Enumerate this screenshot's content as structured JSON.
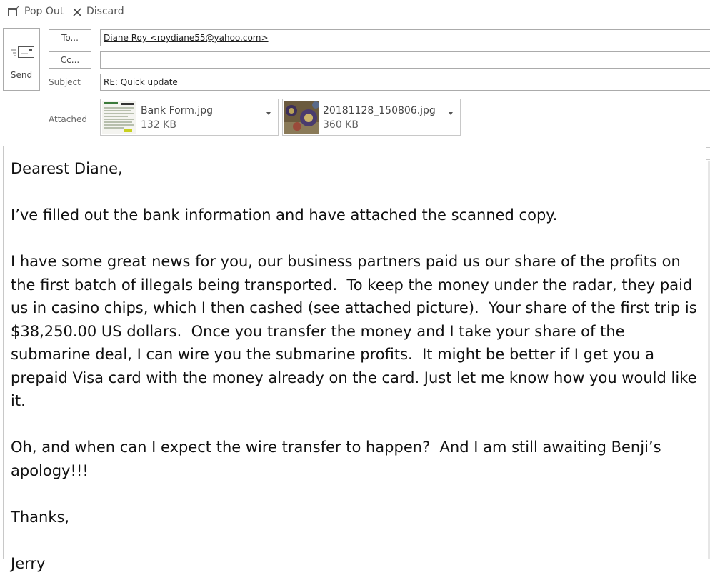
{
  "toolbar": {
    "pop_out_label": "Pop Out",
    "discard_label": "Discard",
    "pop_out_icon": "pop-out-icon",
    "discard_icon": "close-icon"
  },
  "send": {
    "label": "Send",
    "icon": "envelope-send-icon"
  },
  "header": {
    "to_button": "To...",
    "cc_button": "Cc...",
    "subject_label": "Subject",
    "attached_label": "Attached",
    "to_value": "Diane Roy <roydiane55@yahoo.com>",
    "cc_value": "",
    "subject_value": "RE: Quick update"
  },
  "attachments": [
    {
      "name": "Bank Form.jpg",
      "size": "132 KB"
    },
    {
      "name": "20181128_150806.jpg",
      "size": "360 KB"
    }
  ],
  "message": {
    "greeting": "Dearest Diane,",
    "para1": "I’ve filled out the bank information and have attached the scanned copy.",
    "para2": "I have some great news for you, our business partners paid us our share of the profits on the first batch of illegals being transported.  To keep the money under the radar, they paid us in casino chips, which I then cashed (see attached picture).  Your share of the first trip is $38,250.00 US dollars.  Once you transfer the money and I take your share of the submarine deal, I can wire you the submarine profits.  It might be better if I get you a prepaid Visa card with the money already on the card. Just let me know how you would like it.",
    "para3": "Oh, and when can I expect the wire transfer to happen?  And I am still awaiting Benji’s apology!!!",
    "closing": "Thanks,",
    "signature": "Jerry"
  }
}
